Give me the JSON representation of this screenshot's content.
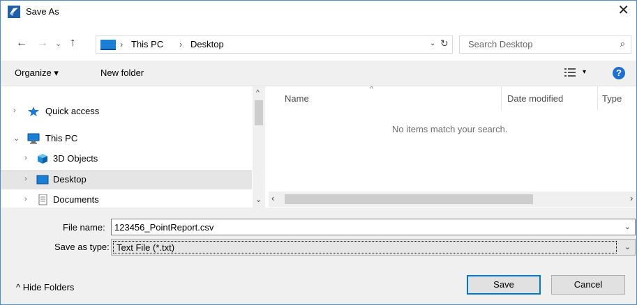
{
  "window": {
    "title": "Save As",
    "close_glyph": "✕"
  },
  "nav_buttons": {
    "back": "←",
    "forward": "→",
    "recent": "⌄",
    "up": "↑"
  },
  "address": {
    "sep": "›",
    "crumbs": [
      "This PC",
      "Desktop"
    ],
    "dropdown": "⌄",
    "refresh": "↻"
  },
  "search": {
    "placeholder": "Search Desktop",
    "icon": "⌕"
  },
  "toolbar": {
    "organize_label": "Organize ▾",
    "new_folder_label": "New folder",
    "view_dropdown": "▾",
    "help_label": "?"
  },
  "nav_pane": {
    "items": [
      {
        "label": "Quick access",
        "chevron": "›",
        "icon": "star-icon"
      },
      {
        "label": "This PC",
        "chevron": "⌄",
        "icon": "computer-icon"
      },
      {
        "label": "3D Objects",
        "chevron": "›",
        "icon": "cube-icon"
      },
      {
        "label": "Desktop",
        "chevron": "›",
        "icon": "desktop-icon",
        "selected": true
      },
      {
        "label": "Documents",
        "chevron": "›",
        "icon": "document-icon"
      }
    ]
  },
  "scroll": {
    "up": "^",
    "down": "⌄",
    "left": "‹",
    "right": "›"
  },
  "file_list": {
    "columns": [
      "Name",
      "Date modified",
      "Type"
    ],
    "sort_caret": "^",
    "empty_message": "No items match your search."
  },
  "save_form": {
    "file_name_label": "File name:",
    "file_name_value": "123456_PointReport.csv",
    "save_as_type_label": "Save as type:",
    "save_as_type_value": "Text File (*.txt)",
    "dropdown_glyph": "⌄"
  },
  "footer": {
    "hide_folders_label": "^  Hide Folders",
    "save_label": "Save",
    "cancel_label": "Cancel"
  },
  "colors": {
    "accent": "#0078d7",
    "selection": "#e5e5e5",
    "panel": "#f0f0f0"
  }
}
